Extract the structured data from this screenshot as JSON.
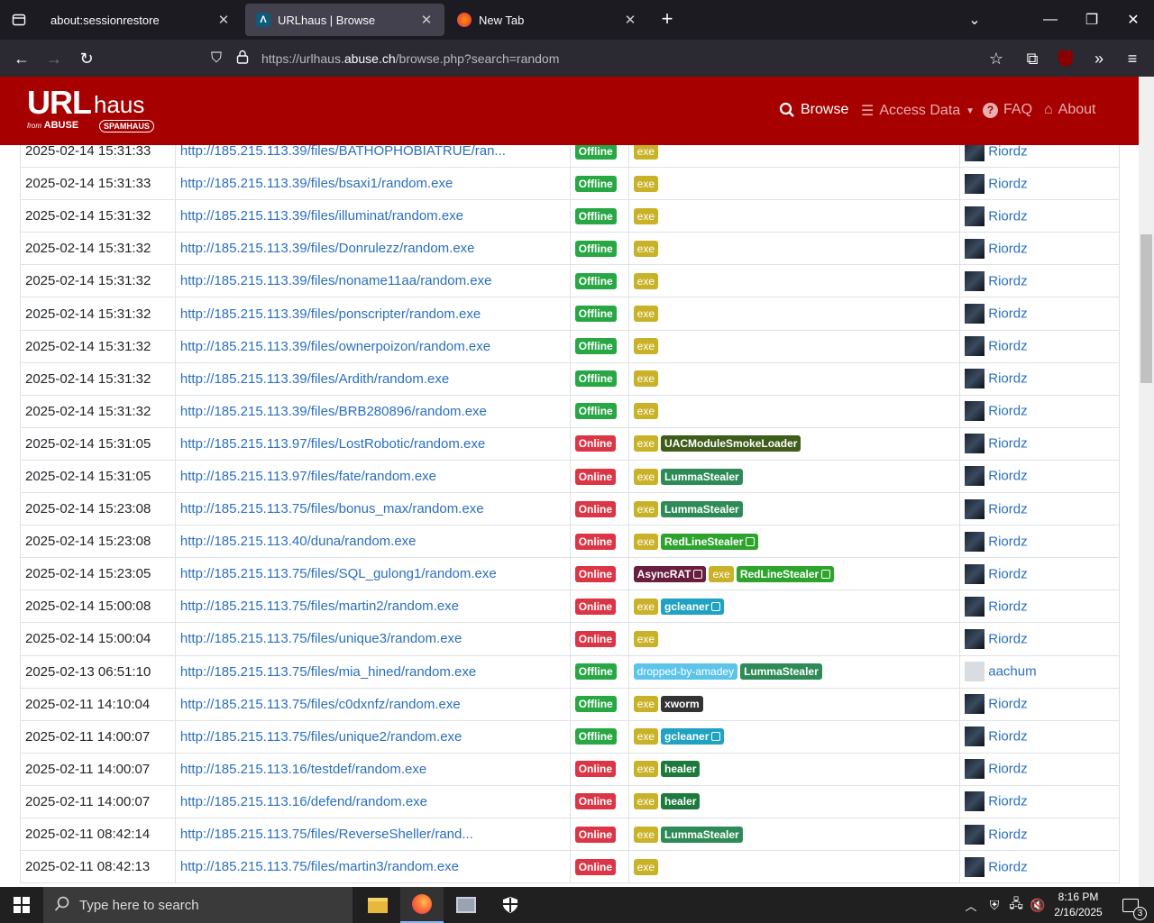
{
  "browser": {
    "tabs": [
      {
        "title": "about:sessionrestore"
      },
      {
        "title": "URLhaus | Browse"
      },
      {
        "title": "New Tab"
      }
    ],
    "url_prefix": "https://urlhaus.",
    "url_domain": "abuse.ch",
    "url_path": "/browse.php?search=random"
  },
  "site": {
    "logo_main": "URL",
    "logo_haus": "haus",
    "logo_from": "from",
    "logo_abuse": "ABUSE",
    "logo_spamhaus": "SPAMHAUS",
    "nav": {
      "browse": "Browse",
      "access": "Access Data",
      "faq": "FAQ",
      "about": "About"
    }
  },
  "rows": [
    {
      "date": "2025-02-14 15:31:33",
      "url": "http://185.215.113.39/files/BATHOPHOBIATRUE/ran...",
      "status": "Offline",
      "tags": [
        "exe"
      ],
      "reporter": "Riordz"
    },
    {
      "date": "2025-02-14 15:31:33",
      "url": "http://185.215.113.39/files/bsaxi1/random.exe",
      "status": "Offline",
      "tags": [
        "exe"
      ],
      "reporter": "Riordz"
    },
    {
      "date": "2025-02-14 15:31:32",
      "url": "http://185.215.113.39/files/illuminat/random.exe",
      "status": "Offline",
      "tags": [
        "exe"
      ],
      "reporter": "Riordz"
    },
    {
      "date": "2025-02-14 15:31:32",
      "url": "http://185.215.113.39/files/Donrulezz/random.exe",
      "status": "Offline",
      "tags": [
        "exe"
      ],
      "reporter": "Riordz"
    },
    {
      "date": "2025-02-14 15:31:32",
      "url": "http://185.215.113.39/files/noname11aa/random.exe",
      "status": "Offline",
      "tags": [
        "exe"
      ],
      "reporter": "Riordz"
    },
    {
      "date": "2025-02-14 15:31:32",
      "url": "http://185.215.113.39/files/ponscripter/random.exe",
      "status": "Offline",
      "tags": [
        "exe"
      ],
      "reporter": "Riordz"
    },
    {
      "date": "2025-02-14 15:31:32",
      "url": "http://185.215.113.39/files/ownerpoizon/random.exe",
      "status": "Offline",
      "tags": [
        "exe"
      ],
      "reporter": "Riordz"
    },
    {
      "date": "2025-02-14 15:31:32",
      "url": "http://185.215.113.39/files/Ardith/random.exe",
      "status": "Offline",
      "tags": [
        "exe"
      ],
      "reporter": "Riordz"
    },
    {
      "date": "2025-02-14 15:31:32",
      "url": "http://185.215.113.39/files/BRB280896/random.exe",
      "status": "Offline",
      "tags": [
        "exe"
      ],
      "reporter": "Riordz"
    },
    {
      "date": "2025-02-14 15:31:05",
      "url": "http://185.215.113.97/files/LostRobotic/random.exe",
      "status": "Online",
      "tags": [
        "exe",
        "UACModuleSmokeLoader"
      ],
      "reporter": "Riordz"
    },
    {
      "date": "2025-02-14 15:31:05",
      "url": "http://185.215.113.97/files/fate/random.exe",
      "status": "Online",
      "tags": [
        "exe",
        "LummaStealer"
      ],
      "reporter": "Riordz"
    },
    {
      "date": "2025-02-14 15:23:08",
      "url": "http://185.215.113.75/files/bonus_max/random.exe",
      "status": "Online",
      "tags": [
        "exe",
        "LummaStealer"
      ],
      "reporter": "Riordz"
    },
    {
      "date": "2025-02-14 15:23:08",
      "url": "http://185.215.113.40/duna/random.exe",
      "status": "Online",
      "tags": [
        "exe",
        "RedLineStealer*"
      ],
      "reporter": "Riordz"
    },
    {
      "date": "2025-02-14 15:23:05",
      "url": "http://185.215.113.75/files/SQL_gulong1/random.exe",
      "status": "Online",
      "tags": [
        "AsyncRAT*",
        "exe",
        "RedLineStealer*"
      ],
      "reporter": "Riordz"
    },
    {
      "date": "2025-02-14 15:00:08",
      "url": "http://185.215.113.75/files/martin2/random.exe",
      "status": "Online",
      "tags": [
        "exe",
        "gcleaner*"
      ],
      "reporter": "Riordz"
    },
    {
      "date": "2025-02-14 15:00:04",
      "url": "http://185.215.113.75/files/unique3/random.exe",
      "status": "Online",
      "tags": [
        "exe"
      ],
      "reporter": "Riordz"
    },
    {
      "date": "2025-02-13 06:51:10",
      "url": "http://185.215.113.75/files/mia_hined/random.exe",
      "status": "Offline",
      "tags": [
        "dropped-by-amadey",
        "LummaStealer"
      ],
      "reporter": "aachum"
    },
    {
      "date": "2025-02-11 14:10:04",
      "url": "http://185.215.113.75/files/c0dxnfz/random.exe",
      "status": "Offline",
      "tags": [
        "exe",
        "xworm"
      ],
      "reporter": "Riordz"
    },
    {
      "date": "2025-02-11 14:00:07",
      "url": "http://185.215.113.75/files/unique2/random.exe",
      "status": "Offline",
      "tags": [
        "exe",
        "gcleaner*"
      ],
      "reporter": "Riordz"
    },
    {
      "date": "2025-02-11 14:00:07",
      "url": "http://185.215.113.16/testdef/random.exe",
      "status": "Online",
      "tags": [
        "exe",
        "healer"
      ],
      "reporter": "Riordz"
    },
    {
      "date": "2025-02-11 14:00:07",
      "url": "http://185.215.113.16/defend/random.exe",
      "status": "Online",
      "tags": [
        "exe",
        "healer"
      ],
      "reporter": "Riordz"
    },
    {
      "date": "2025-02-11 08:42:14",
      "url": "http://185.215.113.75/files/ReverseSheller/rand...",
      "status": "Online",
      "tags": [
        "exe",
        "LummaStealer"
      ],
      "reporter": "Riordz"
    },
    {
      "date": "2025-02-11 08:42:13",
      "url": "http://185.215.113.75/files/martin3/random.exe",
      "status": "Online",
      "tags": [
        "exe"
      ],
      "reporter": "Riordz"
    }
  ],
  "taskbar": {
    "search_placeholder": "Type here to search",
    "time": "8:16 PM",
    "date": "2/16/2025",
    "notif_count": "3"
  }
}
